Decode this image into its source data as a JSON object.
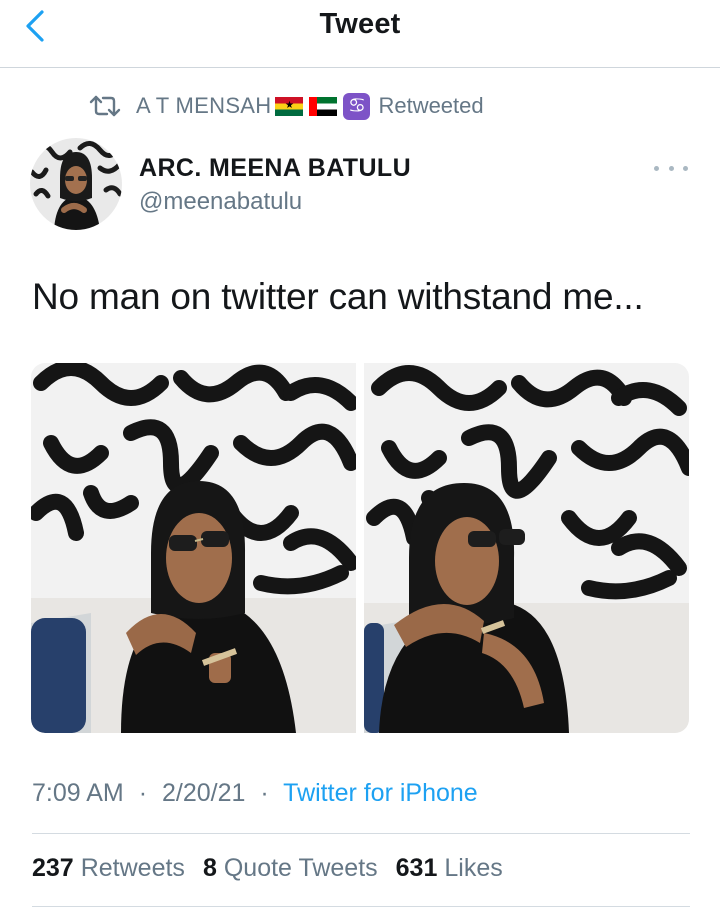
{
  "header": {
    "title": "Tweet"
  },
  "retweet": {
    "user": "A T MENSAH",
    "label": "Retweeted",
    "emoji_flags": [
      "Ghana flag",
      "UAE flag"
    ],
    "emoji_sign": "♋"
  },
  "author": {
    "display_name": "ARC. MEENA BATULU",
    "handle": "@meenabatulu"
  },
  "tweet": {
    "text": "No man on twitter can withstand me..."
  },
  "meta": {
    "time": "7:09 AM",
    "date": "2/20/21",
    "separator": "·",
    "source": "Twitter for iPhone"
  },
  "stats": {
    "retweets_count": "237",
    "retweets_label": "Retweets",
    "quotes_count": "8",
    "quotes_label": "Quote Tweets",
    "likes_count": "631",
    "likes_label": "Likes"
  },
  "colors": {
    "accent": "#1da1f2",
    "secondary_text": "#657786",
    "primary_text": "#14171a"
  },
  "icons": [
    "back-chevron-icon",
    "retweet-icon",
    "more-dots-icon"
  ]
}
